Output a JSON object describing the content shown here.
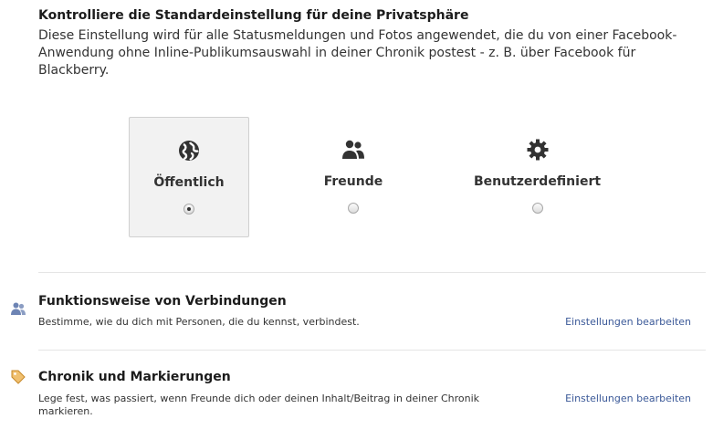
{
  "privacy": {
    "heading": "Kontrolliere die Standardeinstellung für deine Privatsphäre",
    "intro": "Diese Einstellung wird für alle Statusmeldungen und Fotos angewendet, die du von einer Facebook-Anwendung ohne Inline-Publikumsauswahl in deiner Chronik postest - z. B. über Facebook für Blackberry.",
    "options": [
      {
        "label": "Öffentlich",
        "icon": "globe-icon",
        "selected": true
      },
      {
        "label": "Freunde",
        "icon": "friends-icon",
        "selected": false
      },
      {
        "label": "Benutzerdefiniert",
        "icon": "gear-icon",
        "selected": false
      }
    ]
  },
  "sections": [
    {
      "icon": "friends-small-icon",
      "title": "Funktionsweise von Verbindungen",
      "description": "Bestimme, wie du dich mit Personen, die du kennst, verbindest.",
      "link": "Einstellungen bearbeiten"
    },
    {
      "icon": "tag-icon",
      "title": "Chronik und Markierungen",
      "description": "Lege fest, was passiert, wenn Freunde dich oder deinen Inhalt/Beitrag in deiner Chronik markieren.",
      "link": "Einstellungen bearbeiten"
    }
  ],
  "colors": {
    "link": "#3b5998",
    "selected_bg": "#f2f2f2",
    "tag_icon": "#e8a23c",
    "friends_icon": "#6d84b4"
  }
}
